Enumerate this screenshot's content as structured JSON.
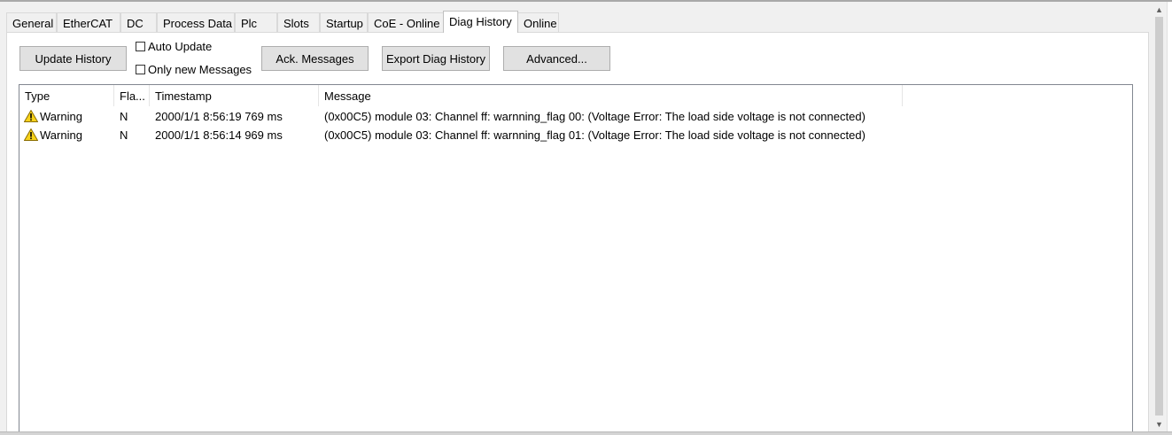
{
  "tabs": [
    {
      "label": "General"
    },
    {
      "label": "EtherCAT"
    },
    {
      "label": "DC"
    },
    {
      "label": "Process Data"
    },
    {
      "label": "Plc"
    },
    {
      "label": "Slots"
    },
    {
      "label": "Startup"
    },
    {
      "label": "CoE - Online"
    },
    {
      "label": "Diag History"
    },
    {
      "label": "Online"
    }
  ],
  "active_tab": "Diag History",
  "toolbar": {
    "update_history": "Update History",
    "auto_update": "Auto Update",
    "auto_update_checked": false,
    "only_new_messages": "Only new Messages",
    "only_new_checked": false,
    "ack_messages": "Ack. Messages",
    "export_diag_history": "Export Diag History",
    "advanced": "Advanced..."
  },
  "list": {
    "columns": [
      "Type",
      "Fla...",
      "Timestamp",
      "Message"
    ],
    "rows": [
      {
        "type": "Warning",
        "flag": "N",
        "timestamp": "2000/1/1 8:56:19 769 ms",
        "message": "(0x00C5) module 03: Channel ff: warnning_flag 00: (Voltage Error: The load side voltage is not connected)"
      },
      {
        "type": "Warning",
        "flag": "N",
        "timestamp": "2000/1/1 8:56:14 969 ms",
        "message": "(0x00C5) module 03: Channel ff: warnning_flag 01: (Voltage Error: The load side voltage is not connected)"
      }
    ]
  },
  "icons": {
    "row_type": "warning-icon",
    "scroll_up": "chevron-up-icon",
    "scroll_down": "chevron-down-icon"
  },
  "colors": {
    "warning_yellow": "#f7d21a",
    "panel_bg": "#f0f0f0",
    "button_bg": "#e1e1e1"
  }
}
